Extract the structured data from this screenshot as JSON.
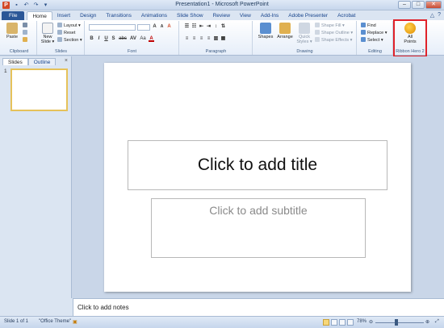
{
  "window": {
    "title": "Presentation1 - Microsoft PowerPoint",
    "app_icon": "P",
    "minimize": "–",
    "maximize": "□",
    "close": "✕"
  },
  "tabs": [
    "File",
    "Home",
    "Insert",
    "Design",
    "Transitions",
    "Animations",
    "Slide Show",
    "Review",
    "View",
    "Add-Ins",
    "Adobe Presenter",
    "Acrobat"
  ],
  "active_tab": "Home",
  "ribbon": {
    "clipboard": {
      "paste": "Paste",
      "label": "Clipboard"
    },
    "slides": {
      "new_slide": "New",
      "new_slide2": "Slide ▾",
      "layout": "Layout ▾",
      "reset": "Reset",
      "section": "Section ▾",
      "label": "Slides"
    },
    "font": {
      "bold": "B",
      "italic": "I",
      "underline": "U",
      "strike": "S",
      "shadow": "abc",
      "grow": "A",
      "shrink": "A",
      "clear": "A",
      "color": "A",
      "spacing": "AV",
      "case": "Aa",
      "label": "Font"
    },
    "paragraph": {
      "label": "Paragraph"
    },
    "drawing": {
      "shapes": "Shapes",
      "arrange": "Arrange",
      "quick_styles": "Quick",
      "quick_styles2": "Styles ▾",
      "shape_fill": "Shape Fill ▾",
      "shape_outline": "Shape Outline ▾",
      "shape_effects": "Shape Effects ▾",
      "label": "Drawing"
    },
    "editing": {
      "find": "Find",
      "replace": "Replace ▾",
      "select": "Select ▾",
      "label": "Editing"
    },
    "custom": {
      "button_line1": "All",
      "button_line2": "Points",
      "label": "Ribbon Hero 2"
    }
  },
  "left_panel": {
    "tabs": [
      "Slides",
      "Outline"
    ],
    "close": "×",
    "slide_number": "1"
  },
  "slide": {
    "title_placeholder": "Click to add title",
    "subtitle_placeholder": "Click to add subtitle"
  },
  "notes": {
    "placeholder": "Click to add notes"
  },
  "status": {
    "slide_info": "Slide 1 of 1",
    "theme": "\"Office Theme\"",
    "zoom": "78%",
    "zoom_out": "⊖",
    "zoom_in": "⊕"
  },
  "colors": {
    "file_tab": "#2b5797",
    "highlight": "#e0222a",
    "thumb_border": "#e6c25a"
  }
}
